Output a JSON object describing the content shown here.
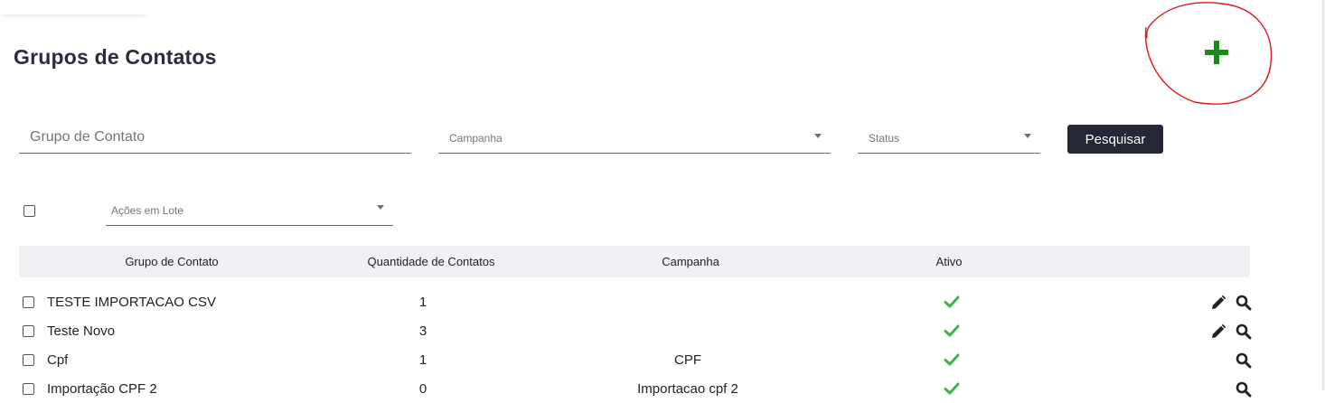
{
  "page": {
    "title": "Grupos de Contatos"
  },
  "filters": {
    "group_placeholder": "Grupo de Contato",
    "campaign_label": "Campanha",
    "status_label": "Status",
    "search_button": "Pesquisar"
  },
  "bulk": {
    "label": "Ações em Lote"
  },
  "table": {
    "headers": [
      "Grupo de Contato",
      "Quantidade de Contatos",
      "Campanha",
      "Ativo"
    ],
    "rows": [
      {
        "name": "TESTE IMPORTACAO CSV",
        "count": "1",
        "campaign": "",
        "active": true,
        "actions": [
          "edit",
          "view"
        ]
      },
      {
        "name": "Teste Novo",
        "count": "3",
        "campaign": "",
        "active": true,
        "actions": [
          "edit",
          "view"
        ]
      },
      {
        "name": "Cpf",
        "count": "1",
        "campaign": "CPF",
        "active": true,
        "actions": [
          "view"
        ]
      },
      {
        "name": "Importação CPF 2",
        "count": "0",
        "campaign": "Importacao cpf 2",
        "active": true,
        "actions": [
          "view"
        ]
      }
    ]
  },
  "icons": {
    "add": "plus-icon",
    "edit": "pencil-icon",
    "view": "search-icon",
    "active": "check-icon",
    "dropdown": "caret-down-icon"
  },
  "colors": {
    "add_icon": "#1a8a1a",
    "annotation_circle": "#e0191a",
    "check": "#3cb449",
    "primary_button": "#252636",
    "header_bg": "#f0f1f5"
  }
}
